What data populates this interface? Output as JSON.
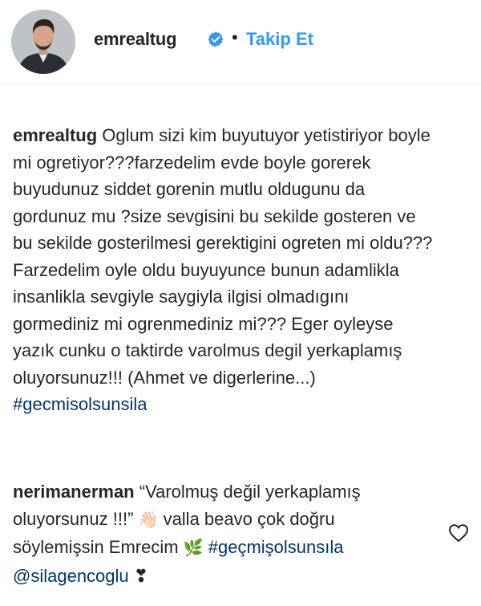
{
  "header": {
    "username": "emrealtug",
    "separator": "•",
    "follow_label": "Takip Et"
  },
  "comments": [
    {
      "username": "emrealtug",
      "text": "Oglum sizi kim buyutuyor yetistiriyor boyle mi ogretiyor???farzedelim evde boyle gorerek buyudunuz siddet gorenin mutlu oldugunu da gordunuz mu ?size sevgisini bu sekilde gosteren ve bu sekilde gosterilmesi gerektigini ogreten mi oldu??? Farzedelim oyle oldu buyuyunce bunun adamlikla insanlikla sevgiyle saygiyla ilgisi olmadıgını gormediniz mi ogrenmediniz mi??? Eger oyleyse yazık cunku o taktirde varolmus degil yerkaplamış oluyorsunuz!!! (Ahmet ve digerlerine...)",
      "hashtag": "#gecmisolsunsila"
    },
    {
      "username": "nerimanerman",
      "text_part1": "“Varolmuş değil yerkaplamış oluyorsunuz !!!”",
      "emoji1": "👋🏻",
      "text_part2": "valla beavo çok doğru söylemişsin Emrecim",
      "emoji2": "🌿",
      "hashtag": "#geçmişolsunsıla",
      "mention": "@silagencoglu",
      "emoji3": "❣"
    }
  ],
  "colors": {
    "link": "#003569",
    "follow": "#3897f0",
    "verified": "#3897f0",
    "text": "#262626"
  },
  "icons": {
    "verified": "verified-badge-icon",
    "like": "heart-outline-icon"
  }
}
